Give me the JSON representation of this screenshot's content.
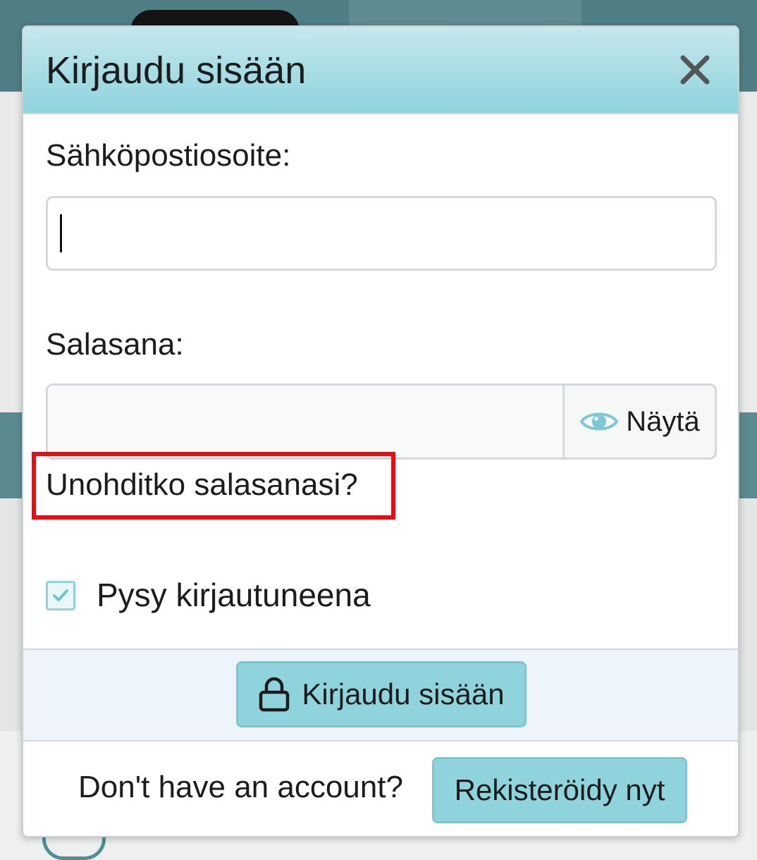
{
  "modal": {
    "title": "Kirjaudu sisään",
    "close_icon": "close-icon"
  },
  "email": {
    "label": "Sähköpostiosoite:",
    "value": "",
    "placeholder": ""
  },
  "password": {
    "label": "Salasana:",
    "value": "",
    "show_label": "Näytä",
    "show_icon": "eye-icon"
  },
  "forgot_password": {
    "label": "Unohditko salasanasi?",
    "highlight_color": "#ef0a12"
  },
  "remember_me": {
    "label": "Pysy kirjautuneena",
    "checked": true
  },
  "submit": {
    "label": "Kirjaudu sisään",
    "icon": "lock-icon"
  },
  "footer": {
    "prompt": "Don't have an account?",
    "register_label": "Rekisteröidy nyt"
  },
  "colors": {
    "accent": "#8fd3dd",
    "header_gradient_top": "#c5e8ed",
    "background_dim": "#4f7f85"
  }
}
